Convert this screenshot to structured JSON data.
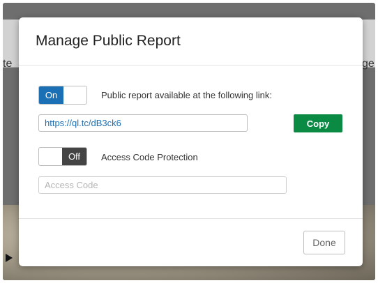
{
  "background": {
    "left_text_fragment": "te",
    "right_text_fragment": "ge"
  },
  "modal": {
    "title": "Manage Public Report",
    "public_toggle": {
      "state_label": "On",
      "state": "on"
    },
    "public_label": "Public report available at the following link:",
    "link_value": "https://ql.tc/dB3ck6",
    "copy_label": "Copy",
    "access_toggle": {
      "state_label": "Off",
      "state": "off"
    },
    "access_label": "Access Code Protection",
    "access_code_placeholder": "Access Code",
    "done_label": "Done"
  },
  "colors": {
    "toggle_on": "#1b6fb4",
    "toggle_off": "#444444",
    "copy_button": "#0b8a44",
    "link_text": "#1b6fb4"
  }
}
